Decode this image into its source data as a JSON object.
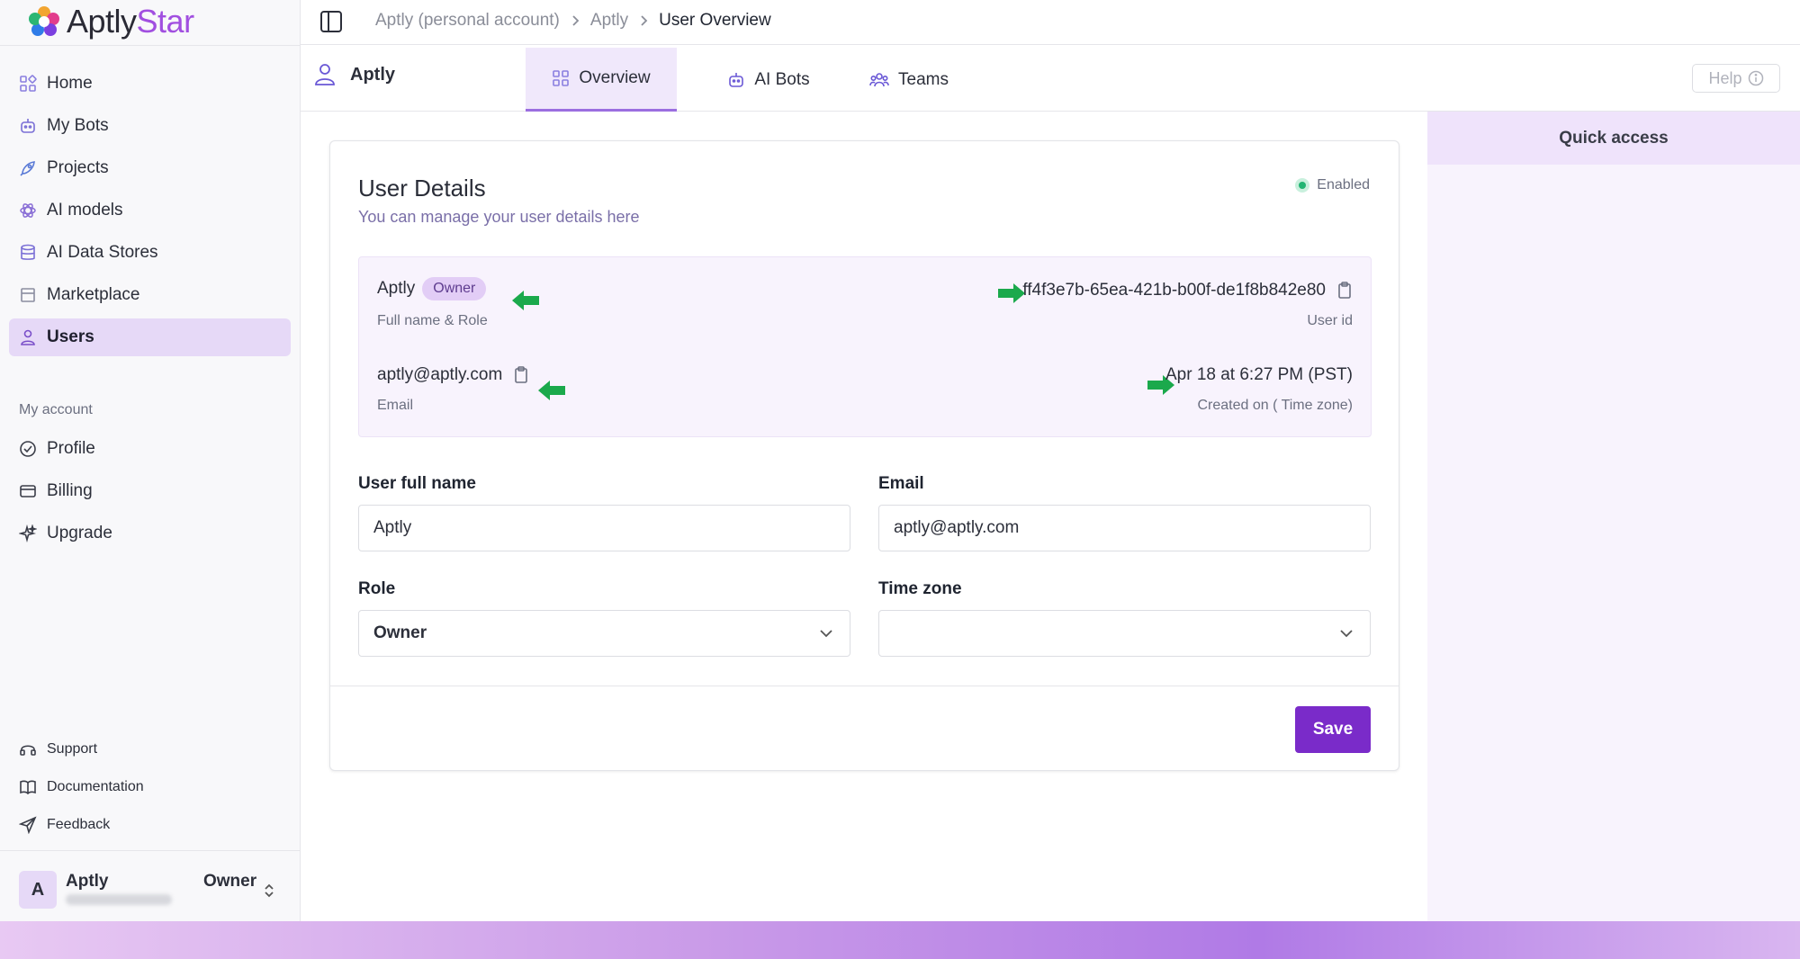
{
  "app": {
    "brand_prefix": "Aptly",
    "brand_suffix": "Star"
  },
  "sidebar": {
    "items": [
      {
        "label": "Home",
        "icon": "grid-icon"
      },
      {
        "label": "My Bots",
        "icon": "bot-icon"
      },
      {
        "label": "Projects",
        "icon": "rocket-icon"
      },
      {
        "label": "AI models",
        "icon": "atom-icon"
      },
      {
        "label": "AI Data Stores",
        "icon": "database-icon"
      },
      {
        "label": "Marketplace",
        "icon": "store-icon"
      },
      {
        "label": "Users",
        "icon": "user-icon",
        "active": true
      }
    ],
    "section_label": "My account",
    "account_items": [
      {
        "label": "Profile",
        "icon": "check-circle-icon"
      },
      {
        "label": "Billing",
        "icon": "credit-card-icon"
      },
      {
        "label": "Upgrade",
        "icon": "sparkle-icon"
      }
    ],
    "footer_items": [
      {
        "label": "Support",
        "icon": "headset-icon"
      },
      {
        "label": "Documentation",
        "icon": "book-icon"
      },
      {
        "label": "Feedback",
        "icon": "send-icon"
      }
    ],
    "user": {
      "initial": "A",
      "name": "Aptly",
      "role": "Owner"
    }
  },
  "breadcrumb": [
    "Aptly (personal account)",
    "Aptly",
    "User Overview"
  ],
  "account_name": "Aptly",
  "tabs": [
    {
      "label": "Overview",
      "icon": "grid-icon"
    },
    {
      "label": "AI Bots",
      "icon": "bot-icon"
    },
    {
      "label": "Teams",
      "icon": "team-icon"
    }
  ],
  "help_label": "Help",
  "card": {
    "title": "User Details",
    "subtitle": "You can manage your user details here",
    "status": "Enabled",
    "info": {
      "name": "Aptly",
      "role_badge": "Owner",
      "name_label": "Full name & Role",
      "user_id": "ff4f3e7b-65ea-421b-b00f-de1f8b842e80",
      "user_id_label": "User id",
      "email": "aptly@aptly.com",
      "email_label": "Email",
      "created": "Apr 18 at 6:27 PM (PST)",
      "created_label": "Created on ( Time zone)"
    },
    "form": {
      "full_name_label": "User full name",
      "full_name_value": "Aptly",
      "email_label": "Email",
      "email_value": "aptly@aptly.com",
      "role_label": "Role",
      "role_value": "Owner",
      "timezone_label": "Time zone",
      "timezone_value": ""
    },
    "save_label": "Save"
  },
  "quick_access": {
    "title": "Quick access"
  },
  "colors": {
    "accent": "#7a2bc9",
    "active_bg": "#e6d9f7",
    "arrow": "#1ba94c"
  }
}
